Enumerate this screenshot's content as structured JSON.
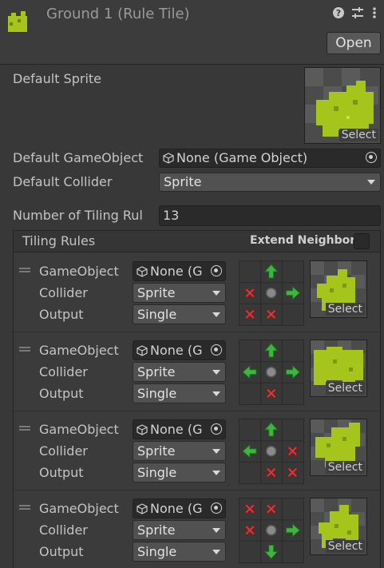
{
  "header": {
    "title": "Ground 1 (Rule Tile)",
    "open_label": "Open",
    "icons": [
      "help-icon",
      "presets-icon",
      "more-menu-icon"
    ]
  },
  "default_sprite": {
    "label": "Default Sprite",
    "select_label": "Select"
  },
  "default_gameobject": {
    "label": "Default GameObject",
    "value": "None (Game Object)"
  },
  "default_collider": {
    "label": "Default Collider",
    "value": "Sprite"
  },
  "number_of_rules": {
    "label": "Number of Tiling Rul",
    "value": "13"
  },
  "tiling_rules": {
    "title": "Tiling Rules",
    "extend_neighbor_label": "Extend Neighbor",
    "rules": [
      {
        "gameobject_label": "GameObject",
        "gameobject_value": "None (G",
        "collider_label": "Collider",
        "collider_value": "Sprite",
        "output_label": "Output",
        "output_value": "Single",
        "select_label": "Select",
        "neighbors": [
          "",
          "up",
          "",
          "x",
          "center",
          "right",
          "x",
          "x",
          ""
        ]
      },
      {
        "gameobject_label": "GameObject",
        "gameobject_value": "None (G",
        "collider_label": "Collider",
        "collider_value": "Sprite",
        "output_label": "Output",
        "output_value": "Single",
        "select_label": "Select",
        "neighbors": [
          "",
          "up",
          "",
          "left",
          "center",
          "right",
          "",
          "x",
          ""
        ]
      },
      {
        "gameobject_label": "GameObject",
        "gameobject_value": "None (G",
        "collider_label": "Collider",
        "collider_value": "Sprite",
        "output_label": "Output",
        "output_value": "Single",
        "select_label": "Select",
        "neighbors": [
          "",
          "up",
          "",
          "left",
          "center",
          "x",
          "",
          "x",
          "x"
        ]
      },
      {
        "gameobject_label": "GameObject",
        "gameobject_value": "None (G",
        "collider_label": "Collider",
        "collider_value": "Sprite",
        "output_label": "Output",
        "output_value": "Single",
        "select_label": "Select",
        "neighbors": [
          "x",
          "x",
          "",
          "x",
          "center",
          "right",
          "",
          "down",
          ""
        ]
      }
    ]
  },
  "colors": {
    "background": "#383838",
    "field": "#2a2a2a",
    "dropdown": "#515151",
    "sprite_green": "#a6c51c",
    "arrow_green": "#3fb43f",
    "x_red": "#d23b3b"
  }
}
